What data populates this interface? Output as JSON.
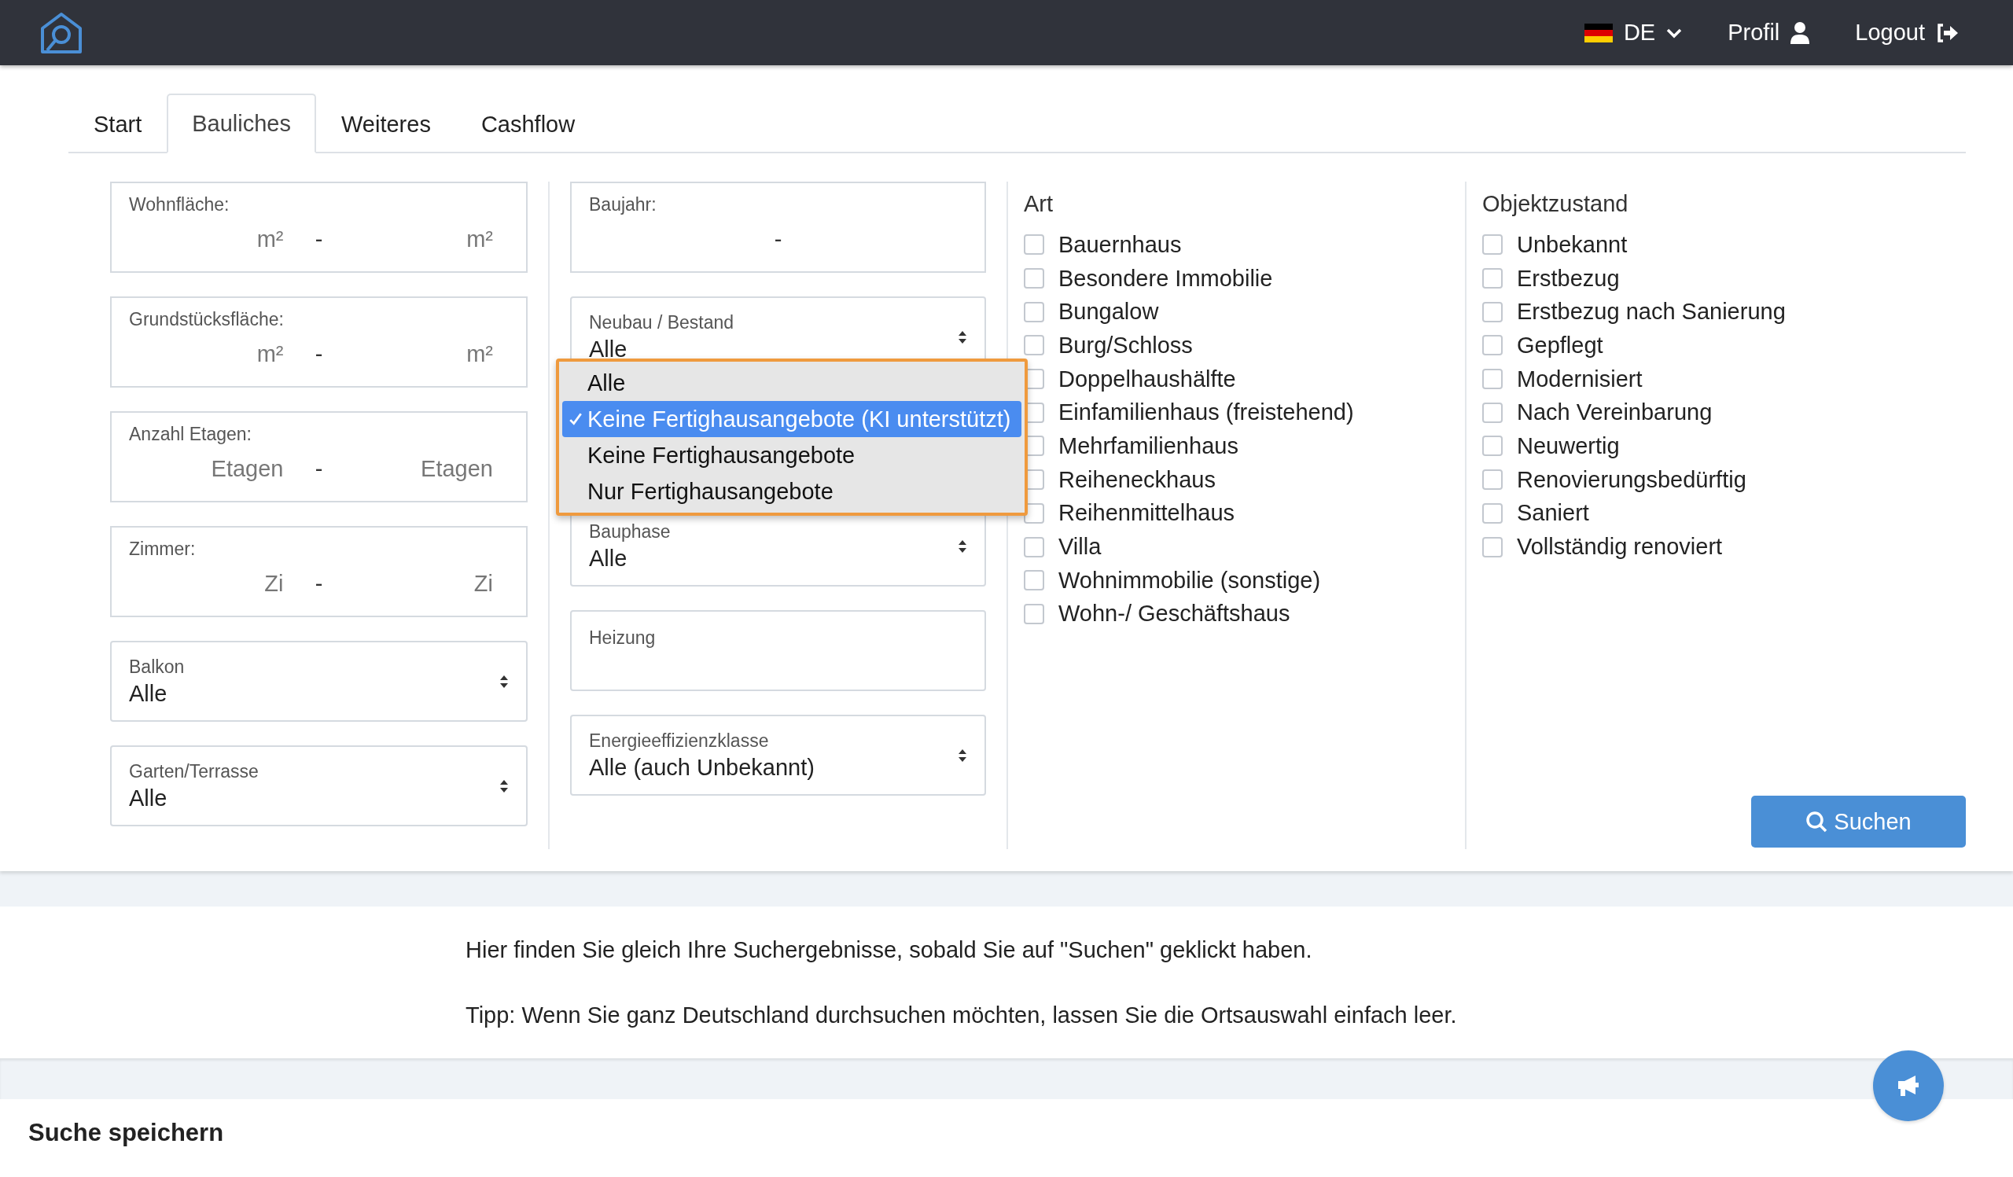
{
  "header": {
    "language": {
      "code": "DE"
    },
    "profile": "Profil",
    "logout": "Logout"
  },
  "tabs": [
    {
      "label": "Start",
      "selected": false
    },
    {
      "label": "Bauliches",
      "selected": true
    },
    {
      "label": "Weiteres",
      "selected": false
    },
    {
      "label": "Cashflow",
      "selected": false
    }
  ],
  "column_1": [
    {
      "kind": "range",
      "label": "Wohnfläche:",
      "min_unit": "m²",
      "separator": "-",
      "max_unit": "m²"
    },
    {
      "kind": "range",
      "label": "Grundstücksfläche:",
      "min_unit": "m²",
      "separator": "-",
      "max_unit": "m²"
    },
    {
      "kind": "range",
      "label": "Anzahl Etagen:",
      "min_unit": "Etagen",
      "separator": "-",
      "max_unit": "Etagen"
    },
    {
      "kind": "range",
      "label": "Zimmer:",
      "min_unit": "Zi",
      "separator": "-",
      "max_unit": "Zi"
    },
    {
      "kind": "select",
      "label": "Balkon",
      "value": "Alle"
    },
    {
      "kind": "select",
      "label": "Garten/Terrasse",
      "value": "Alle"
    }
  ],
  "column_2": [
    {
      "kind": "range",
      "label": "Baujahr:",
      "separator": "-"
    },
    {
      "kind": "select",
      "label": "Neubau / Bestand",
      "value": "Alle"
    },
    {
      "kind": "popup",
      "options": [
        {
          "label": "Alle",
          "selected": false
        },
        {
          "label": "Keine Fertighausangebote (KI unterstützt)",
          "selected": true
        },
        {
          "label": "Keine Fertighausangebote",
          "selected": false
        },
        {
          "label": "Nur Fertighausangebote",
          "selected": false
        }
      ]
    },
    {
      "kind": "select",
      "label": "Bauphase",
      "value": "Alle"
    },
    {
      "kind": "text",
      "label": "Heizung"
    },
    {
      "kind": "select",
      "label": "Energieeffizienzklasse",
      "value": "Alle (auch Unbekannt)"
    }
  ],
  "art": {
    "title": "Art",
    "options": [
      {
        "label": "Bauernhaus",
        "checked": false
      },
      {
        "label": "Besondere Immobilie",
        "checked": false
      },
      {
        "label": "Bungalow",
        "checked": false
      },
      {
        "label": "Burg/Schloss",
        "checked": false
      },
      {
        "label": "Doppelhaushälfte",
        "checked": false
      },
      {
        "label": "Einfamilienhaus (freistehend)",
        "checked": false
      },
      {
        "label": "Mehrfamilienhaus",
        "checked": false
      },
      {
        "label": "Reiheneckhaus",
        "checked": false
      },
      {
        "label": "Reihenmittelhaus",
        "checked": false
      },
      {
        "label": "Villa",
        "checked": false
      },
      {
        "label": "Wohnimmobilie (sonstige)",
        "checked": false
      },
      {
        "label": "Wohn-/ Geschäftshaus",
        "checked": false
      }
    ]
  },
  "objektzustand": {
    "title": "Objektzustand",
    "options": [
      {
        "label": "Unbekannt",
        "checked": false
      },
      {
        "label": "Erstbezug",
        "checked": false
      },
      {
        "label": "Erstbezug nach Sanierung",
        "checked": false
      },
      {
        "label": "Gepflegt",
        "checked": false
      },
      {
        "label": "Modernisiert",
        "checked": false
      },
      {
        "label": "Nach Vereinbarung",
        "checked": false
      },
      {
        "label": "Neuwertig",
        "checked": false
      },
      {
        "label": "Renovierungsbedürftig",
        "checked": false
      },
      {
        "label": "Saniert",
        "checked": false
      },
      {
        "label": "Vollständig renoviert",
        "checked": false
      }
    ]
  },
  "search_button": "Suchen",
  "info": [
    "Hier finden Sie gleich Ihre Suchergebnisse, sobald Sie auf \"Suchen\" geklickt haben.",
    "Tipp: Wenn Sie ganz Deutschland durchsuchen möchten, lassen Sie die Ortsauswahl einfach leer."
  ],
  "save_search": {
    "title": "Suche speichern"
  }
}
